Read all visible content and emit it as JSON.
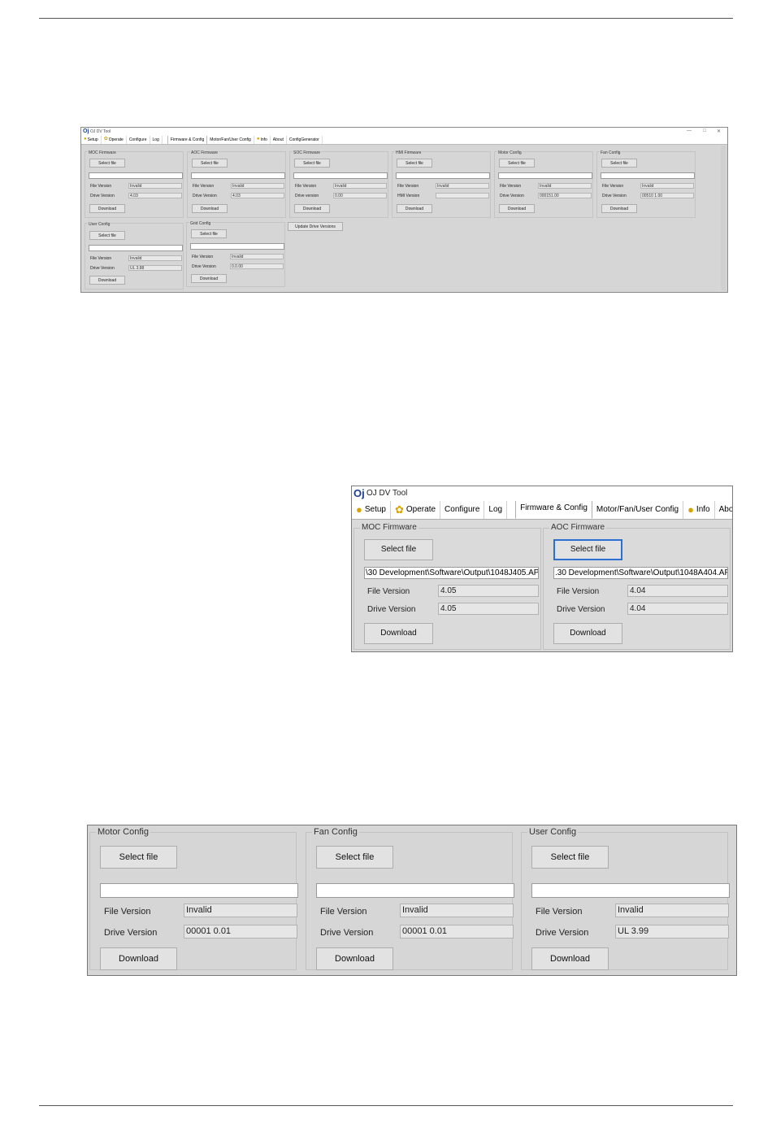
{
  "window_title": "OJ DV Tool",
  "tabs": [
    {
      "label": "Setup",
      "icon": "person-icon"
    },
    {
      "label": "Operate",
      "icon": "fan-icon"
    },
    {
      "label": "Configure",
      "icon": ""
    },
    {
      "label": "Log",
      "icon": ""
    },
    {
      "label": "Firmware & Config",
      "icon": "",
      "active": true
    },
    {
      "label": "Motor/Fan/User Config",
      "icon": ""
    },
    {
      "label": "Info",
      "icon": "info-person-icon"
    },
    {
      "label": "About",
      "icon": ""
    },
    {
      "label": "ConfigGenerator",
      "icon": ""
    }
  ],
  "overview": {
    "groups": [
      {
        "title": "MOC Firmware",
        "select": "Select file",
        "path": "",
        "l1": "File Version",
        "v1": "Invalid",
        "l2": "Drive Version",
        "v2": "4.03",
        "download": "Download"
      },
      {
        "title": "AOC Firmware",
        "select": "Select file",
        "path": "",
        "l1": "File Version",
        "v1": "Invalid",
        "l2": "Drive Version",
        "v2": "4.03",
        "download": "Download"
      },
      {
        "title": "SOC Firmware",
        "select": "Select file",
        "path": "",
        "l1": "File Version",
        "v1": "Invalid",
        "l2": "Drive version",
        "v2": "0.00",
        "download": "Download"
      },
      {
        "title": "HMI Firmware",
        "select": "Select file",
        "path": "",
        "l1": "File Version",
        "v1": "Invalid",
        "l2": "HMI Version",
        "v2": "",
        "download": "Download"
      },
      {
        "title": "Motor Config",
        "select": "Select file",
        "path": "",
        "l1": "File Version",
        "v1": "Invalid",
        "l2": "Drive Version",
        "v2": "000151.00",
        "download": "Download"
      },
      {
        "title": "Fan Config",
        "select": "Select file",
        "path": "",
        "l1": "File Version",
        "v1": "Invalid",
        "l2": "Drive Version",
        "v2": "00510 1.00",
        "download": "Download"
      },
      {
        "title": "User Config",
        "select": "Select file",
        "path": "",
        "l1": "File Version",
        "v1": "Invalid",
        "l2": "Drive Version",
        "v2": "UL 3.88",
        "download": "Download"
      },
      {
        "title": "Grid Config",
        "select": "Select file",
        "path": "",
        "l1": "File Version",
        "v1": "Invalid",
        "l2": "Drive Version",
        "v2": "0.0.00",
        "download": "Download"
      }
    ],
    "update_button": "Update Drive Versions"
  },
  "zoom_firmware": {
    "groups": [
      {
        "title": "MOC Firmware",
        "select": "Select file",
        "path": "\\30 Development\\Software\\Output\\1048J405.APP.s",
        "l1": "File Version",
        "v1": "4.05",
        "l2": "Drive Version",
        "v2": "4.05",
        "download": "Download"
      },
      {
        "title": "AOC Firmware",
        "select": "Select file",
        "path": ".30 Development\\Software\\Output\\1048A404.APP.s",
        "l1": "File Version",
        "v1": "4.04",
        "l2": "Drive Version",
        "v2": "4.04",
        "download": "Download"
      }
    ]
  },
  "zoom_config": {
    "groups": [
      {
        "title": "Motor Config",
        "select": "Select file",
        "path": "",
        "l1": "File Version",
        "v1": "Invalid",
        "l2": "Drive Version",
        "v2": "00001 0.01",
        "download": "Download"
      },
      {
        "title": "Fan Config",
        "select": "Select file",
        "path": "",
        "l1": "File Version",
        "v1": "Invalid",
        "l2": "Drive Version",
        "v2": "00001 0.01",
        "download": "Download"
      },
      {
        "title": "User Config",
        "select": "Select file",
        "path": "",
        "l1": "File Version",
        "v1": "Invalid",
        "l2": "Drive Version",
        "v2": "UL 3.99",
        "download": "Download"
      }
    ]
  },
  "colors": {
    "page_bg": "#ffffff",
    "window_bg": "#d6d6d6",
    "focus_border": "#2a6fd1",
    "logo": "#1d3f8f"
  }
}
